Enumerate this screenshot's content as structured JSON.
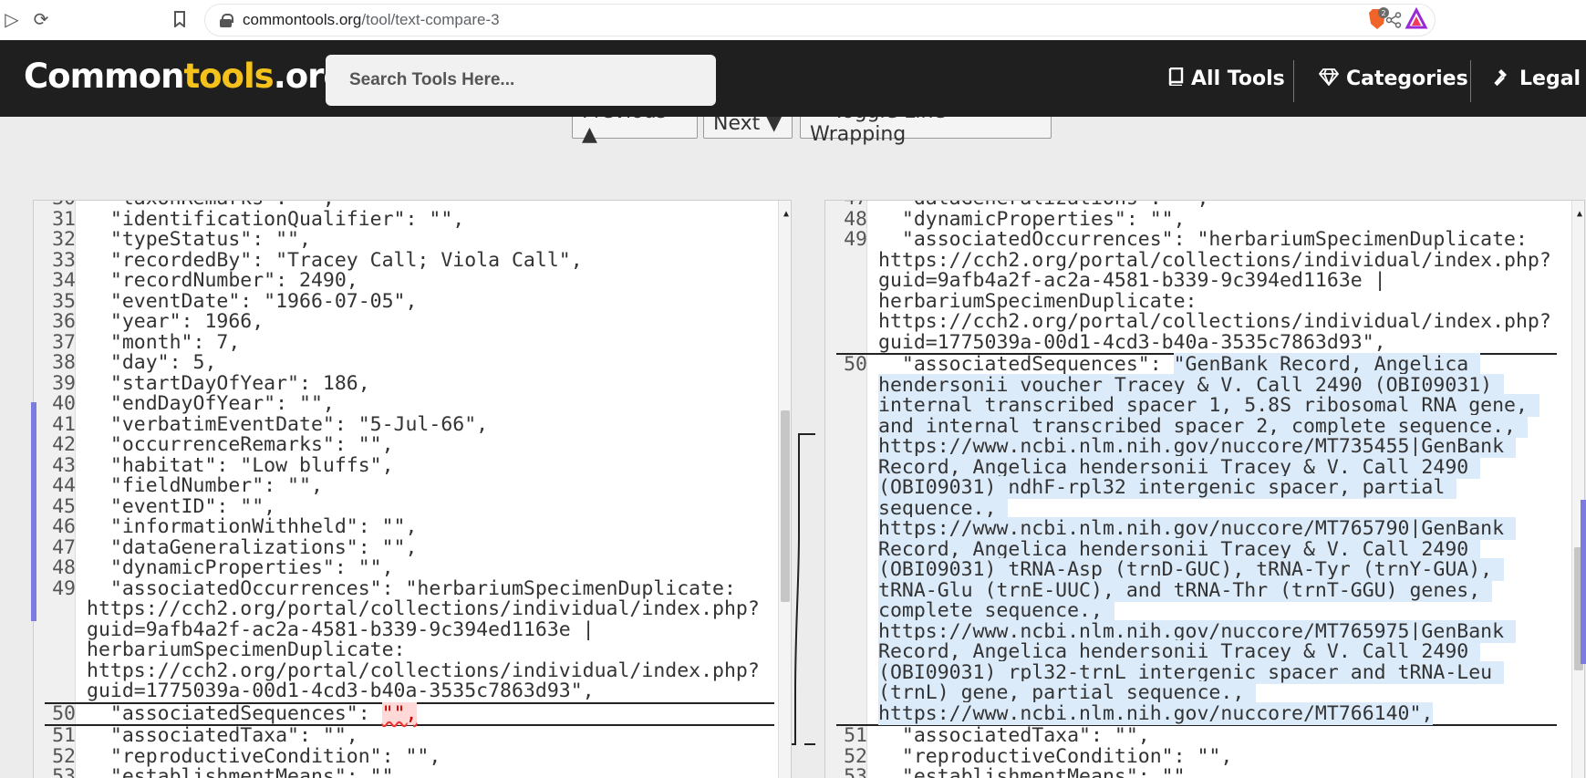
{
  "browser": {
    "url_host": "commontools.org",
    "url_path": "/tool/text-compare-3"
  },
  "header": {
    "logo_part1": "Common",
    "logo_part2": "tools",
    "logo_part3": ".org",
    "search_placeholder": "Search Tools Here...",
    "nav": {
      "all_tools": "All Tools",
      "categories": "Categories",
      "legal": "Legal"
    }
  },
  "toolbar": {
    "previous": "Previous ▲",
    "next": "Next ▼",
    "toggle_wrap": "↩ Toggle Line Wrapping"
  },
  "left_pane": {
    "lines": [
      {
        "n": "30",
        "t": "  \"taxonRemarks\": \"\","
      },
      {
        "n": "31",
        "t": "  \"identificationQualifier\": \"\","
      },
      {
        "n": "32",
        "t": "  \"typeStatus\": \"\","
      },
      {
        "n": "33",
        "t": "  \"recordedBy\": \"Tracey Call; Viola Call\","
      },
      {
        "n": "34",
        "t": "  \"recordNumber\": 2490,"
      },
      {
        "n": "35",
        "t": "  \"eventDate\": \"1966-07-05\","
      },
      {
        "n": "36",
        "t": "  \"year\": 1966,"
      },
      {
        "n": "37",
        "t": "  \"month\": 7,"
      },
      {
        "n": "38",
        "t": "  \"day\": 5,"
      },
      {
        "n": "39",
        "t": "  \"startDayOfYear\": 186,"
      },
      {
        "n": "40",
        "t": "  \"endDayOfYear\": \"\","
      },
      {
        "n": "41",
        "t": "  \"verbatimEventDate\": \"5-Jul-66\","
      },
      {
        "n": "42",
        "t": "  \"occurrenceRemarks\": \"\","
      },
      {
        "n": "43",
        "t": "  \"habitat\": \"Low bluffs\","
      },
      {
        "n": "44",
        "t": "  \"fieldNumber\": \"\","
      },
      {
        "n": "45",
        "t": "  \"eventID\": \"\","
      },
      {
        "n": "46",
        "t": "  \"informationWithheld\": \"\","
      },
      {
        "n": "47",
        "t": "  \"dataGeneralizations\": \"\","
      },
      {
        "n": "48",
        "t": "  \"dynamicProperties\": \"\","
      },
      {
        "n": "49",
        "t": "  \"associatedOccurrences\": \"herbariumSpecimenDuplicate: https://cch2.org/portal/collections/individual/index.php?guid=9afb4a2f-ac2a-4581-b339-9c394ed1163e | herbariumSpecimenDuplicate: https://cch2.org/portal/collections/individual/index.php?guid=1775039a-00d1-4cd3-b40a-3535c7863d93\","
      }
    ],
    "changed_line": {
      "n": "50",
      "prefix": "  \"associatedSequences\": ",
      "removed": "\"\","
    },
    "after_lines": [
      {
        "n": "51",
        "t": "  \"associatedTaxa\": \"\","
      },
      {
        "n": "52",
        "t": "  \"reproductiveCondition\": \"\","
      },
      {
        "n": "53",
        "t": "  \"establishmentMeans\": \"\","
      }
    ]
  },
  "right_pane": {
    "lines": [
      {
        "n": "47",
        "t": "  \"dataGeneralizations\": \"\","
      },
      {
        "n": "48",
        "t": "  \"dynamicProperties\": \"\","
      },
      {
        "n": "49",
        "t": "  \"associatedOccurrences\": \"herbariumSpecimenDuplicate: https://cch2.org/portal/collections/individual/index.php?guid=9afb4a2f-ac2a-4581-b339-9c394ed1163e | herbariumSpecimenDuplicate: https://cch2.org/portal/collections/individual/index.php?guid=1775039a-00d1-4cd3-b40a-3535c7863d93\","
      }
    ],
    "changed_line": {
      "n": "50",
      "prefix": "  \"associatedSequences\": ",
      "added": "\"GenBank Record, Angelica hendersonii voucher Tracey & V. Call 2490 (OBI09031) internal transcribed spacer 1, 5.8S ribosomal RNA gene, and internal transcribed spacer 2, complete sequence., https://www.ncbi.nlm.nih.gov/nuccore/MT735455|GenBank Record, Angelica hendersonii Tracey & V. Call 2490 (OBI09031) ndhF-rpl32 intergenic spacer, partial sequence., https://www.ncbi.nlm.nih.gov/nuccore/MT765790|GenBank Record, Angelica hendersonii Tracey & V. Call 2490 (OBI09031) tRNA-Asp (trnD-GUC), tRNA-Tyr (trnY-GUA), tRNA-Glu (trnE-UUC), and tRNA-Thr (trnT-GGU) genes, complete sequence., https://www.ncbi.nlm.nih.gov/nuccore/MT765975|GenBank Record, Angelica hendersonii Tracey & V. Call 2490 (OBI09031) rpl32-trnL intergenic spacer and tRNA-Leu (trnL) gene, partial sequence., https://www.ncbi.nlm.nih.gov/nuccore/MT766140\","
    },
    "after_lines": [
      {
        "n": "51",
        "t": "  \"associatedTaxa\": \"\","
      },
      {
        "n": "52",
        "t": "  \"reproductiveCondition\": \"\","
      },
      {
        "n": "53",
        "t": "  \"establishmentMeans\": \"\","
      }
    ]
  },
  "colors": {
    "header_bg": "#1f1f1f",
    "logo_accent": "#f4c21b",
    "added_highlight": "#dcebfa",
    "removed_highlight": "#ffd8d8",
    "change_marker": "#7b7be0"
  }
}
